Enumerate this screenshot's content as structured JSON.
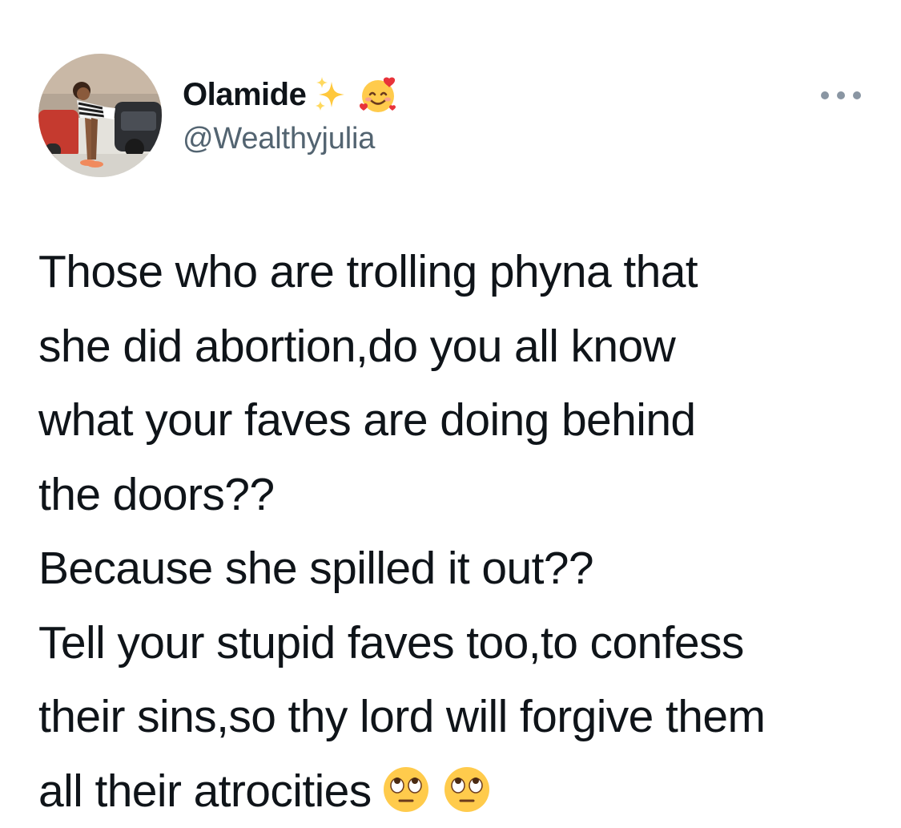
{
  "author": {
    "display_name": "Olamide",
    "name_emojis": [
      "sparkles-emoji",
      "smiling-face-with-hearts-emoji"
    ],
    "handle": "@Wealthyjulia",
    "avatar": "profile-photo"
  },
  "more_icon": "more-options-icon",
  "tweet": {
    "lines": [
      "Those who are trolling phyna that",
      "she did abortion,do you all know",
      "what your faves are doing behind",
      "the doors??",
      "Because she spilled it out??",
      "Tell your stupid faves too,to confess",
      "their sins,so thy lord will forgive them",
      "all their atrocities"
    ],
    "trailing_emojis": [
      "face-with-rolling-eyes-emoji",
      "face-with-rolling-eyes-emoji"
    ]
  },
  "colors": {
    "text": "#0f1419",
    "secondary": "#536471",
    "icon": "#8a96a3",
    "background": "#ffffff"
  }
}
